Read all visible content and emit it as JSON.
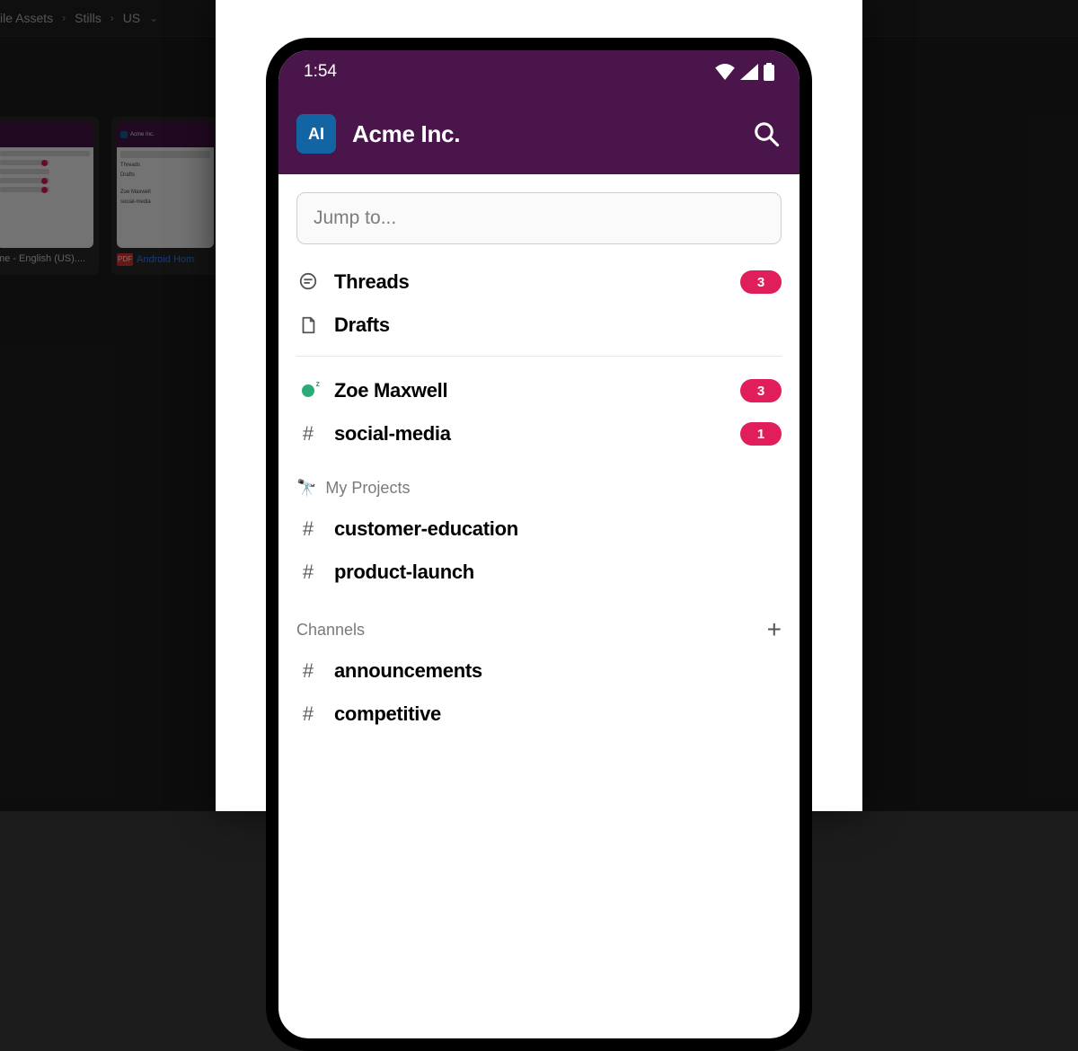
{
  "breadcrumb": {
    "item1": "ile Assets",
    "item2": "Stills",
    "item3": "US"
  },
  "thumbs": {
    "t1_label": "me - English (US)....",
    "t2_label": "Android Hom",
    "t2_lines": {
      "a": "Threads",
      "b": "Drafts",
      "c": "Zoe Maxwell",
      "d": "social-media"
    },
    "pdf": "PDF"
  },
  "phone": {
    "status_time": "1:54",
    "workspace_badge": "AI",
    "workspace_title": "Acme Inc.",
    "jump_placeholder": "Jump to...",
    "threads": {
      "label": "Threads",
      "badge": "3"
    },
    "drafts": {
      "label": "Drafts"
    },
    "dm_zoe": {
      "label": "Zoe Maxwell",
      "badge": "3"
    },
    "ch_social": {
      "label": "social-media",
      "badge": "1"
    },
    "section_projects": "My Projects",
    "ch_cust_edu": "customer-education",
    "ch_prod_launch": "product-launch",
    "section_channels": "Channels",
    "ch_announce": "announcements",
    "ch_competitive": "competitive"
  }
}
